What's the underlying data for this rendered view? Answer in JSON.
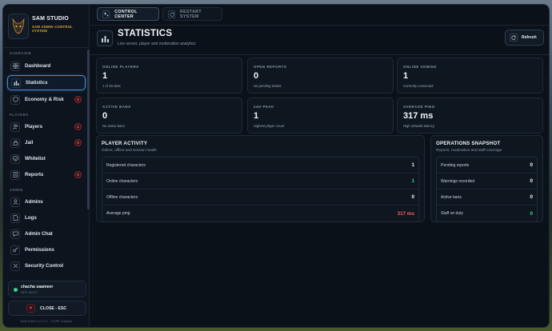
{
  "sidebar": {
    "brand_title": "SAM STUDIO",
    "brand_subtitle": "SAM ADMIN CONTROL SYSTEM",
    "sections": {
      "overview": "OVERVIEW",
      "players": "PLAYERS",
      "admin": "ADMIN"
    },
    "items": {
      "dashboard": {
        "label": "Dashboard",
        "icon": "grid-icon"
      },
      "statistics": {
        "label": "Statistics",
        "icon": "bar-chart-icon"
      },
      "economy": {
        "label": "Economy & Risk",
        "icon": "shield-money-icon",
        "badge": "0"
      },
      "players": {
        "label": "Players",
        "icon": "users-icon",
        "badge": "1"
      },
      "jail": {
        "label": "Jail",
        "icon": "lock-icon",
        "badge": "0"
      },
      "whitelist": {
        "label": "Whitelist",
        "icon": "shield-check-icon"
      },
      "reports": {
        "label": "Reports",
        "icon": "report-icon",
        "badge": "0"
      },
      "admins": {
        "label": "Admins",
        "icon": "admin-icon"
      },
      "logs": {
        "label": "Logs",
        "icon": "file-icon"
      },
      "admin_chat": {
        "label": "Admin Chat",
        "icon": "chat-icon"
      },
      "permissions": {
        "label": "Permissions",
        "icon": "key-icon"
      },
      "security_control": {
        "label": "Security Control",
        "icon": "security-icon"
      }
    },
    "user": {
      "name": "chacha saameer",
      "status": "OFF DUTY"
    },
    "close_label": "CLOSE - ESC",
    "version": "SAM Admin v1.0.0 - VORP Adapter"
  },
  "topbar": {
    "control_center": "CONTROL CENTER",
    "restart_system": "RESTART SYSTEM"
  },
  "header": {
    "title": "STATISTICS",
    "subtitle": "Live server, player and moderation analytics",
    "refresh_label": "Refresh"
  },
  "stats": [
    {
      "label": "ONLINE PLAYERS",
      "value": "1",
      "caption": "1 of 48 slots"
    },
    {
      "label": "OPEN REPORTS",
      "value": "0",
      "caption": "No pending tickets"
    },
    {
      "label": "ONLINE ADMINS",
      "value": "1",
      "caption": "Currently connected"
    },
    {
      "label": "ACTIVE BANS",
      "value": "0",
      "caption": "No active bans"
    },
    {
      "label": "24H PEAK",
      "value": "1",
      "caption": "Highest player count"
    },
    {
      "label": "AVERAGE PING",
      "value": "317 ms",
      "caption": "High network latency"
    }
  ],
  "player_activity": {
    "title": "PLAYER ACTIVITY",
    "subtitle": "Online, offline and session health",
    "rows": [
      {
        "label": "Registered characters",
        "value": "1"
      },
      {
        "label": "Online characters",
        "value": "1"
      },
      {
        "label": "Offline characters",
        "value": "0"
      },
      {
        "label": "Average ping",
        "value": "317 ms"
      }
    ]
  },
  "operations": {
    "title": "OPERATIONS SNAPSHOT",
    "subtitle": "Reports, moderation and staff coverage",
    "rows": [
      {
        "label": "Pending reports",
        "value": "0"
      },
      {
        "label": "Warnings recorded",
        "value": "0"
      },
      {
        "label": "Active bans",
        "value": "0"
      },
      {
        "label": "Staff on duty",
        "value": "0"
      }
    ]
  },
  "colors": {
    "accent": "#4a90d9",
    "brand_gold": "#e2a93a",
    "success": "#3ecf8e",
    "danger": "#ff5a63"
  }
}
